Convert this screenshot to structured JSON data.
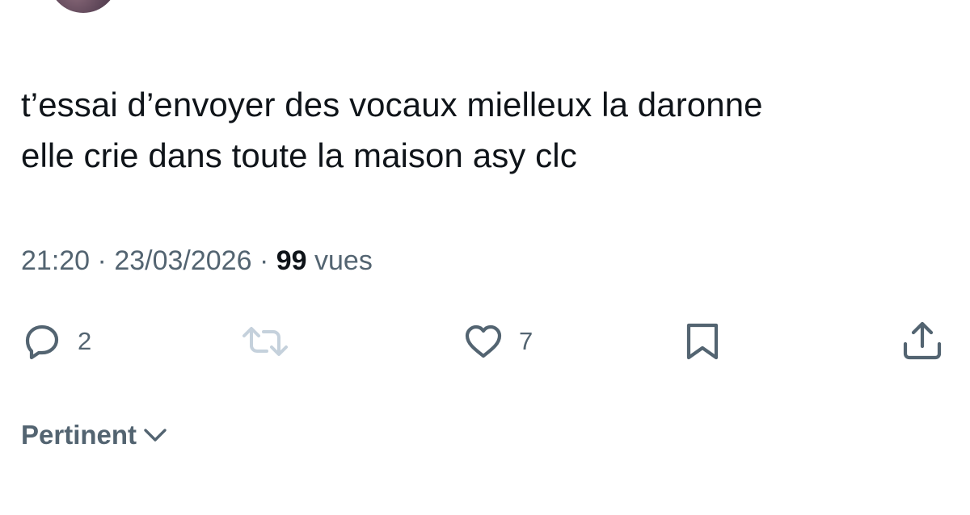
{
  "tweet": {
    "text_line_1": "t’essai d’envoyer des vocaux mielleux la daronne",
    "text_line_2": "elle crie dans toute la maison asy clc"
  },
  "meta": {
    "time": "21:20",
    "separator": "·",
    "date": "23/03/2026",
    "views_count": "99",
    "views_label": "vues"
  },
  "actions": {
    "reply": {
      "icon": "reply-icon",
      "count": "2"
    },
    "retweet": {
      "icon": "retweet-icon"
    },
    "like": {
      "icon": "heart-icon",
      "count": "7"
    },
    "bookmark": {
      "icon": "bookmark-icon"
    },
    "share": {
      "icon": "share-icon"
    }
  },
  "replies_sort": {
    "label": "Pertinent",
    "icon": "chevron-down-icon"
  },
  "colors": {
    "text": "#0f1419",
    "secondary": "#536471",
    "retweet_disabled": "#c5d1dc"
  }
}
